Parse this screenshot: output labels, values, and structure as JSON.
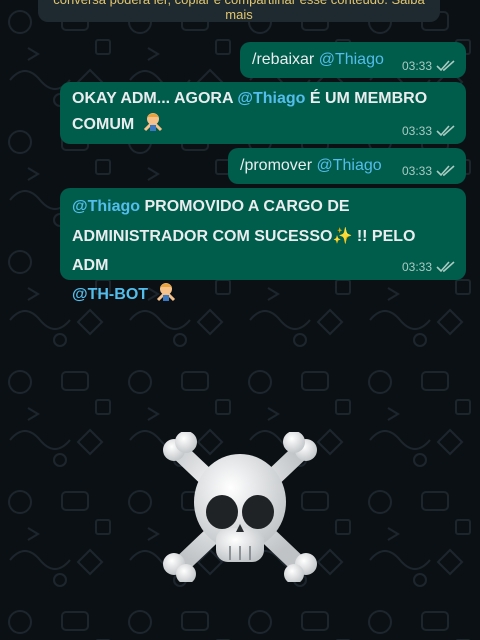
{
  "system_notice": {
    "text": "conversa poderá ler, copiar e compartilhar esse conteúdo. Saiba mais"
  },
  "messages": [
    {
      "command": "/rebaixar",
      "mention": "@Thiago",
      "time": "03:33",
      "status": "read"
    },
    {
      "text_pre": "OKAY ADM... AGORA ",
      "mention": "@Thiago",
      "text_post": " É UM MEMBRO COMUM",
      "emoji": "person-gesturing-no-emoji",
      "time": "03:33",
      "status": "read"
    },
    {
      "command": "/promover",
      "mention": "@Thiago",
      "time": "03:33",
      "status": "read"
    },
    {
      "mention": "@Thiago",
      "text_post": " PROMOVIDO A CARGO DE ADMINISTRADOR COM SUCESSO",
      "sparkle": "✨",
      "text_tail": " !! PELO ADM ",
      "mention2": "@TH-BOT",
      "emoji": "person-gesturing-no-emoji",
      "time": "03:33",
      "status": "read"
    }
  ],
  "sticker": {
    "name": "skull-crossbones-sticker"
  },
  "colors": {
    "outgoing_bubble": "#005c4b",
    "mention": "#53bdeb",
    "background": "#0b1014",
    "notice_text": "#e0c56e"
  }
}
